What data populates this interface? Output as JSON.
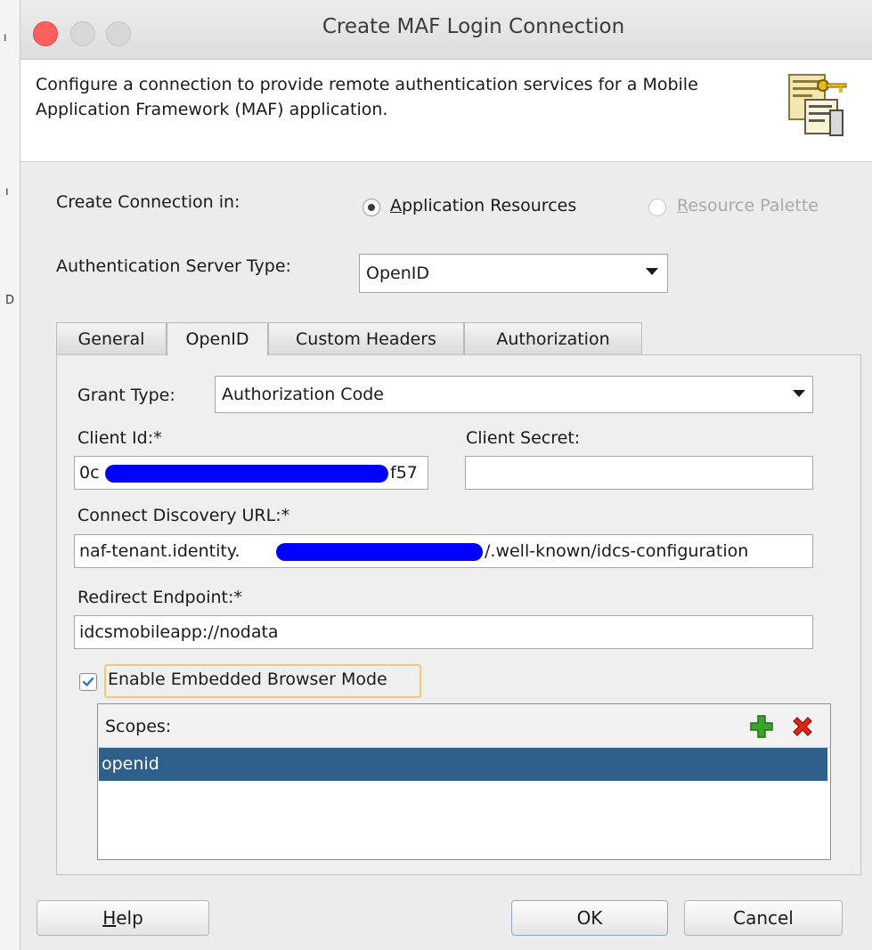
{
  "window": {
    "title": "Create MAF Login Connection"
  },
  "header": {
    "description": "Configure a connection to provide remote authentication services for a Mobile Application Framework (MAF) application.",
    "icon": "connection-key-icon"
  },
  "create_connection": {
    "label": "Create Connection in:",
    "options": [
      {
        "label_mnemonic": "A",
        "label_rest": "pplication Resources",
        "selected": true,
        "enabled": true
      },
      {
        "label_mnemonic": "R",
        "label_rest": "esource Palette",
        "selected": false,
        "enabled": false
      }
    ]
  },
  "auth_server_type": {
    "label": "Authentication Server Type:",
    "value": "OpenID"
  },
  "tabs": [
    {
      "label": "General",
      "active": false
    },
    {
      "label": "OpenID",
      "active": true
    },
    {
      "label": "Custom Headers",
      "active": false
    },
    {
      "label": "Authorization",
      "active": false
    }
  ],
  "openid": {
    "grant_type_label": "Grant Type:",
    "grant_type_value": "Authorization Code",
    "client_id_label": "Client Id:*",
    "client_id_prefix": "0c",
    "client_id_suffix": "f57",
    "client_secret_label": "Client Secret:",
    "client_secret_value": "",
    "discovery_label": "Connect Discovery URL:*",
    "discovery_prefix": "naf-tenant.identity.",
    "discovery_suffix": "/.well-known/idcs-configuration",
    "redirect_label": "Redirect Endpoint:*",
    "redirect_value": "idcsmobileapp://nodata",
    "embedded_label": "Enable Embedded Browser Mode",
    "embedded_checked": true,
    "scopes_label": "Scopes:",
    "scopes": [
      "openid"
    ]
  },
  "buttons": {
    "help_mnemonic": "H",
    "help_rest": "elp",
    "ok": "OK",
    "cancel": "Cancel"
  },
  "colors": {
    "selection": "#2e5f8a",
    "redaction": "#0000ff",
    "close_button": "#fc605c",
    "add_icon": "#3aa52a",
    "remove_icon": "#e0251b"
  }
}
